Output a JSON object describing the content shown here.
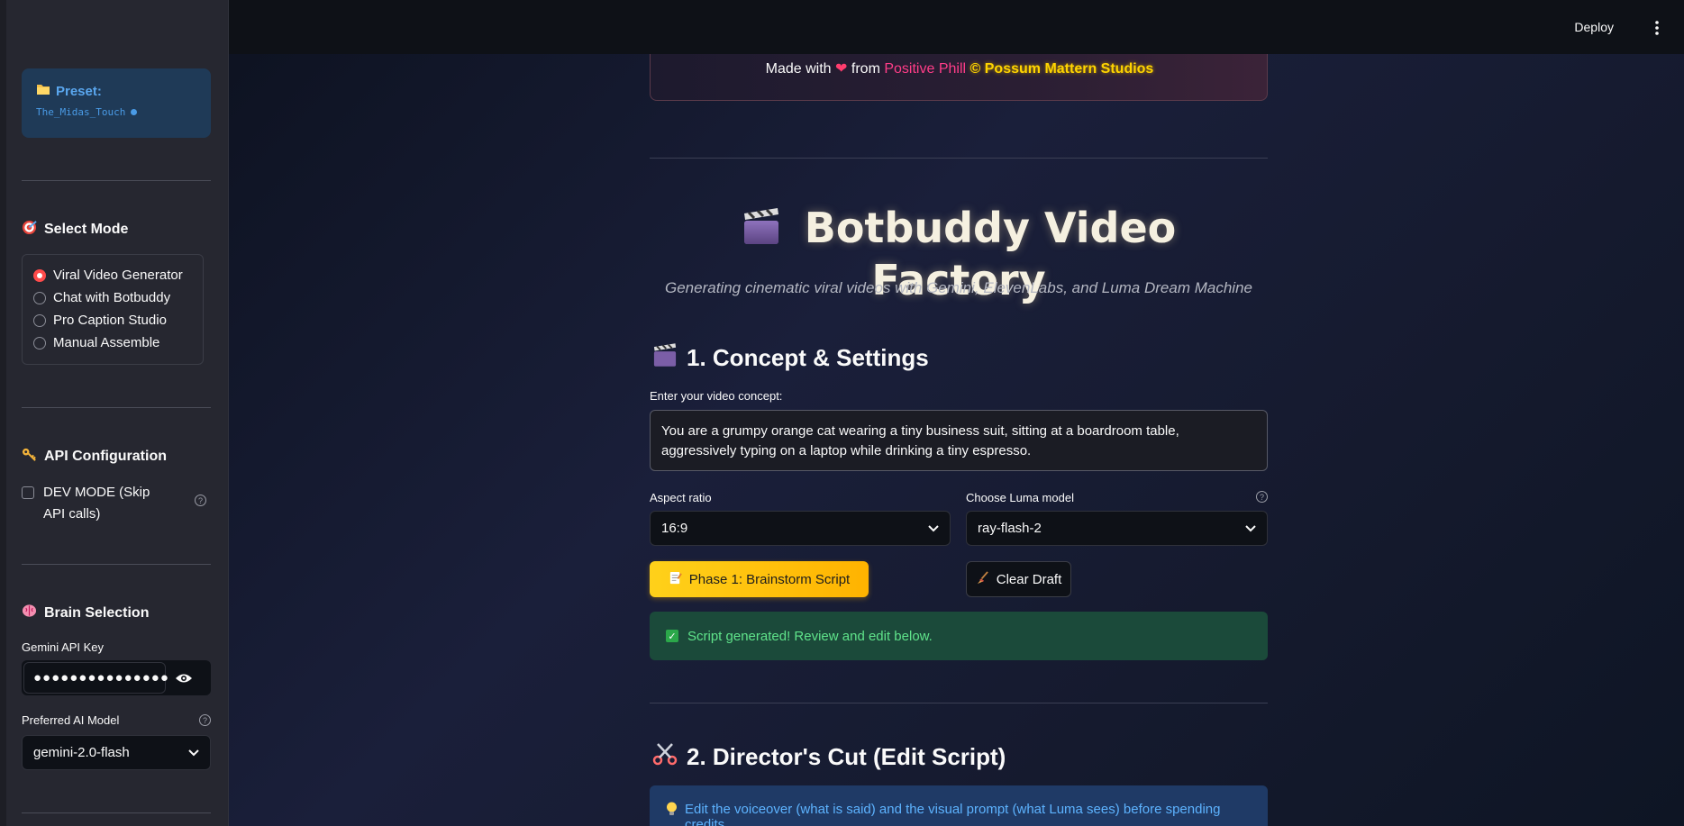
{
  "sidebar": {
    "preset": {
      "title": "Preset:",
      "value": "The_Midas_Touch"
    },
    "select_mode": {
      "heading": "Select Mode",
      "options": [
        "Viral Video Generator",
        "Chat with Botbuddy",
        "Pro Caption Studio",
        "Manual Assemble"
      ],
      "selected": "Viral Video Generator"
    },
    "api_config": {
      "heading": "API Configuration",
      "dev_mode_label": "DEV MODE (Skip API calls)",
      "dev_mode_checked": false
    },
    "brain": {
      "heading": "Brain Selection",
      "api_key_label": "Gemini API Key",
      "api_key_value": "●●●●●●●●●●●●●●●",
      "model_label": "Preferred AI Model",
      "model_value": "gemini-2.0-flash"
    }
  },
  "header": {
    "deploy_label": "Deploy"
  },
  "footer_banner": {
    "made_with": "Made with",
    "from": "from",
    "author": "Positive Phill",
    "copyright": "©",
    "studio": "Possum Mattern Studios"
  },
  "main": {
    "title": "Botbuddy Video Factory",
    "subtitle": "Generating cinematic viral videos with Gemini, ElevenLabs, and Luma Dream Machine",
    "section1": {
      "heading": "1. Concept & Settings",
      "concept_label": "Enter your video concept:",
      "concept_value": "You are a grumpy orange cat wearing a tiny business suit, sitting at a boardroom table, aggressively typing on a laptop while drinking a tiny espresso.",
      "aspect_label": "Aspect ratio",
      "aspect_value": "16:9",
      "luma_label": "Choose Luma model",
      "luma_value": "ray-flash-2",
      "brainstorm_button": "Phase 1: Brainstorm Script",
      "clear_button": "Clear Draft",
      "success_message": "Script generated! Review and edit below."
    },
    "section2": {
      "heading": "2. Director's Cut (Edit Script)",
      "info_message": "Edit the voiceover (what is said) and the visual prompt (what Luma sees) before spending credits."
    }
  },
  "colors": {
    "accent_red": "#ff4b4b",
    "primary_button": "#ffc107",
    "success_bg": "#1b4a3a",
    "info_bg": "#1f3a66",
    "author_pink": "#ff3d88",
    "studio_gold": "#ffd400"
  },
  "icons": {
    "preset": "folder-icon",
    "select_mode": "target-icon",
    "api_config": "key-icon",
    "brain": "brain-icon",
    "title": "clapperboard-icon",
    "section1": "clapperboard-icon",
    "section2": "scissors-icon",
    "brainstorm": "memo-icon",
    "clear": "broom-icon",
    "info": "lightbulb-icon"
  }
}
